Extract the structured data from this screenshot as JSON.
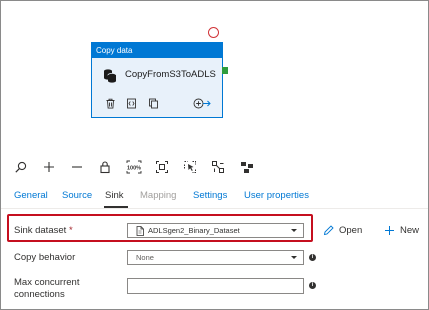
{
  "activity": {
    "type_label": "Copy data",
    "name": "CopyFromS3ToADLS"
  },
  "tabs": [
    {
      "label": "General"
    },
    {
      "label": "Source"
    },
    {
      "label": "Sink"
    },
    {
      "label": "Mapping"
    },
    {
      "label": "Settings"
    },
    {
      "label": "User properties"
    }
  ],
  "active_tab": "Sink",
  "form": {
    "sink_dataset": {
      "label": "Sink dataset",
      "required_mark": "*",
      "value": "ADLSgen2_Binary_Dataset",
      "open_label": "Open",
      "new_label": "New"
    },
    "copy_behavior": {
      "label": "Copy behavior",
      "value": "None"
    },
    "max_concurrent": {
      "label_line1": "Max concurrent",
      "label_line2": "connections",
      "value": ""
    }
  },
  "colors": {
    "accent": "#0078d4",
    "highlight": "#c50f1f",
    "success_port": "#2e9c3d",
    "error_port": "#d13438"
  }
}
